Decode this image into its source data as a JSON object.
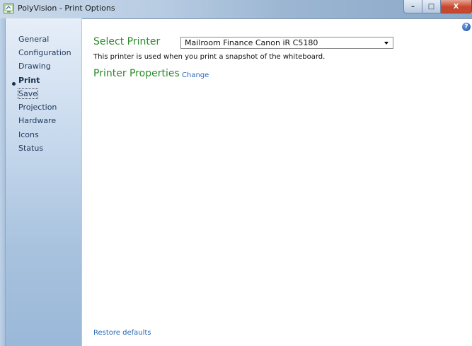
{
  "window": {
    "title": "PolyVision - Print Options",
    "minimize_glyph": "–",
    "maximize_glyph": "□",
    "close_glyph": "X"
  },
  "sidebar": {
    "items": [
      {
        "label": "General"
      },
      {
        "label": "Configuration"
      },
      {
        "label": "Drawing"
      },
      {
        "label": "Print",
        "active": true
      },
      {
        "label": "Save",
        "focused": true
      },
      {
        "label": "Projection"
      },
      {
        "label": "Hardware"
      },
      {
        "label": "Icons"
      },
      {
        "label": "Status"
      }
    ]
  },
  "help": {
    "icon": "help-icon",
    "glyph": "?"
  },
  "main": {
    "select_printer_heading": "Select Printer",
    "printer_select": {
      "value": "Mailroom Finance Canon iR C5180"
    },
    "printer_description": "This printer is used when you print a snapshot of the whiteboard.",
    "printer_properties_heading": "Printer Properties",
    "change_link": "Change",
    "restore_defaults_link": "Restore defaults"
  },
  "colors": {
    "heading_green": "#2a8a2a",
    "link_blue": "#2a6ab8",
    "sidebar_text": "#1e395b"
  }
}
